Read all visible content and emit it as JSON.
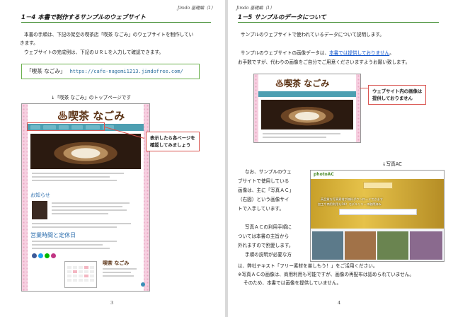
{
  "left_page": {
    "running_header": "Jimdo 基礎編（1）",
    "section_title": "1－4 本書で制作するサンプルのウェブサイト",
    "para1_line1": "本書の手順は、下記の架空の喫茶店「喫茶 なごみ」のウェブサイトを制作してい",
    "para1_line2": "きます。",
    "para2": "ウェブサイトの完成例は、下記のＵＲＬを入力して確認できます。",
    "url_box": {
      "name": "「喫茶 なごみ」",
      "url": "https://cafe-nagomi1213.jimdofree.com/"
    },
    "figure_caption": "↓「喫茶 なごみ」のトップページです",
    "callout_line1": "表示したら各ページを",
    "callout_line2": "確認してみましょう",
    "website": {
      "logo": "喫茶 なごみ",
      "news_heading": "お知らせ",
      "hours_heading": "営業時間と定休日",
      "footer_logo": "喫茶 なごみ"
    },
    "page_number": "3"
  },
  "right_page": {
    "running_header": "Jimdo 基礎編（1）",
    "section_title": "1－5 サンプルのデータについて",
    "line1": "サンプルのウェブサイトで使われているデータについて説明します。",
    "line2_pre": "サンプルのウェブサイトの画像データは、",
    "line2_link": "本書では提供しておりません",
    "line2_post": "。",
    "line3": "お手数ですが、代わりの画像をご自分でご用意くださいますようお願い致します。",
    "website_logo": "喫茶 なごみ",
    "callout_line1": "ウェブサイト内の画像は",
    "callout_line2": "提供しておりません",
    "photoac_caption": "↓写真AC",
    "photoac_site": {
      "logo": "photoAC",
      "banner_line1": "高品質な写真素材が無料ダウンロードできます",
      "banner_line2": "加工や商用利用もOK！モデルリリース取得済み"
    },
    "wrap_lines": [
      "なお、サンプルのウェ",
      "ブサイトで使用している",
      "画像は、主に「写真ＡＣ」",
      "（右図）という画像サイ",
      "トで入手しています。",
      "",
      "写真ＡＣの利用手順に",
      "ついては本書の主旨から",
      "外れますので割愛します。",
      "手順の説明が必要な方"
    ],
    "full_line": "は、弊社テキスト「フリー素材を楽しもう！」をご活用ください。",
    "note_line1": "※写真ＡＣの画像は、商用利用も可能ですが、画像の再配布は認められていません。",
    "note_line2": "そのため、本書では画像を提供していません。",
    "page_number": "4"
  }
}
